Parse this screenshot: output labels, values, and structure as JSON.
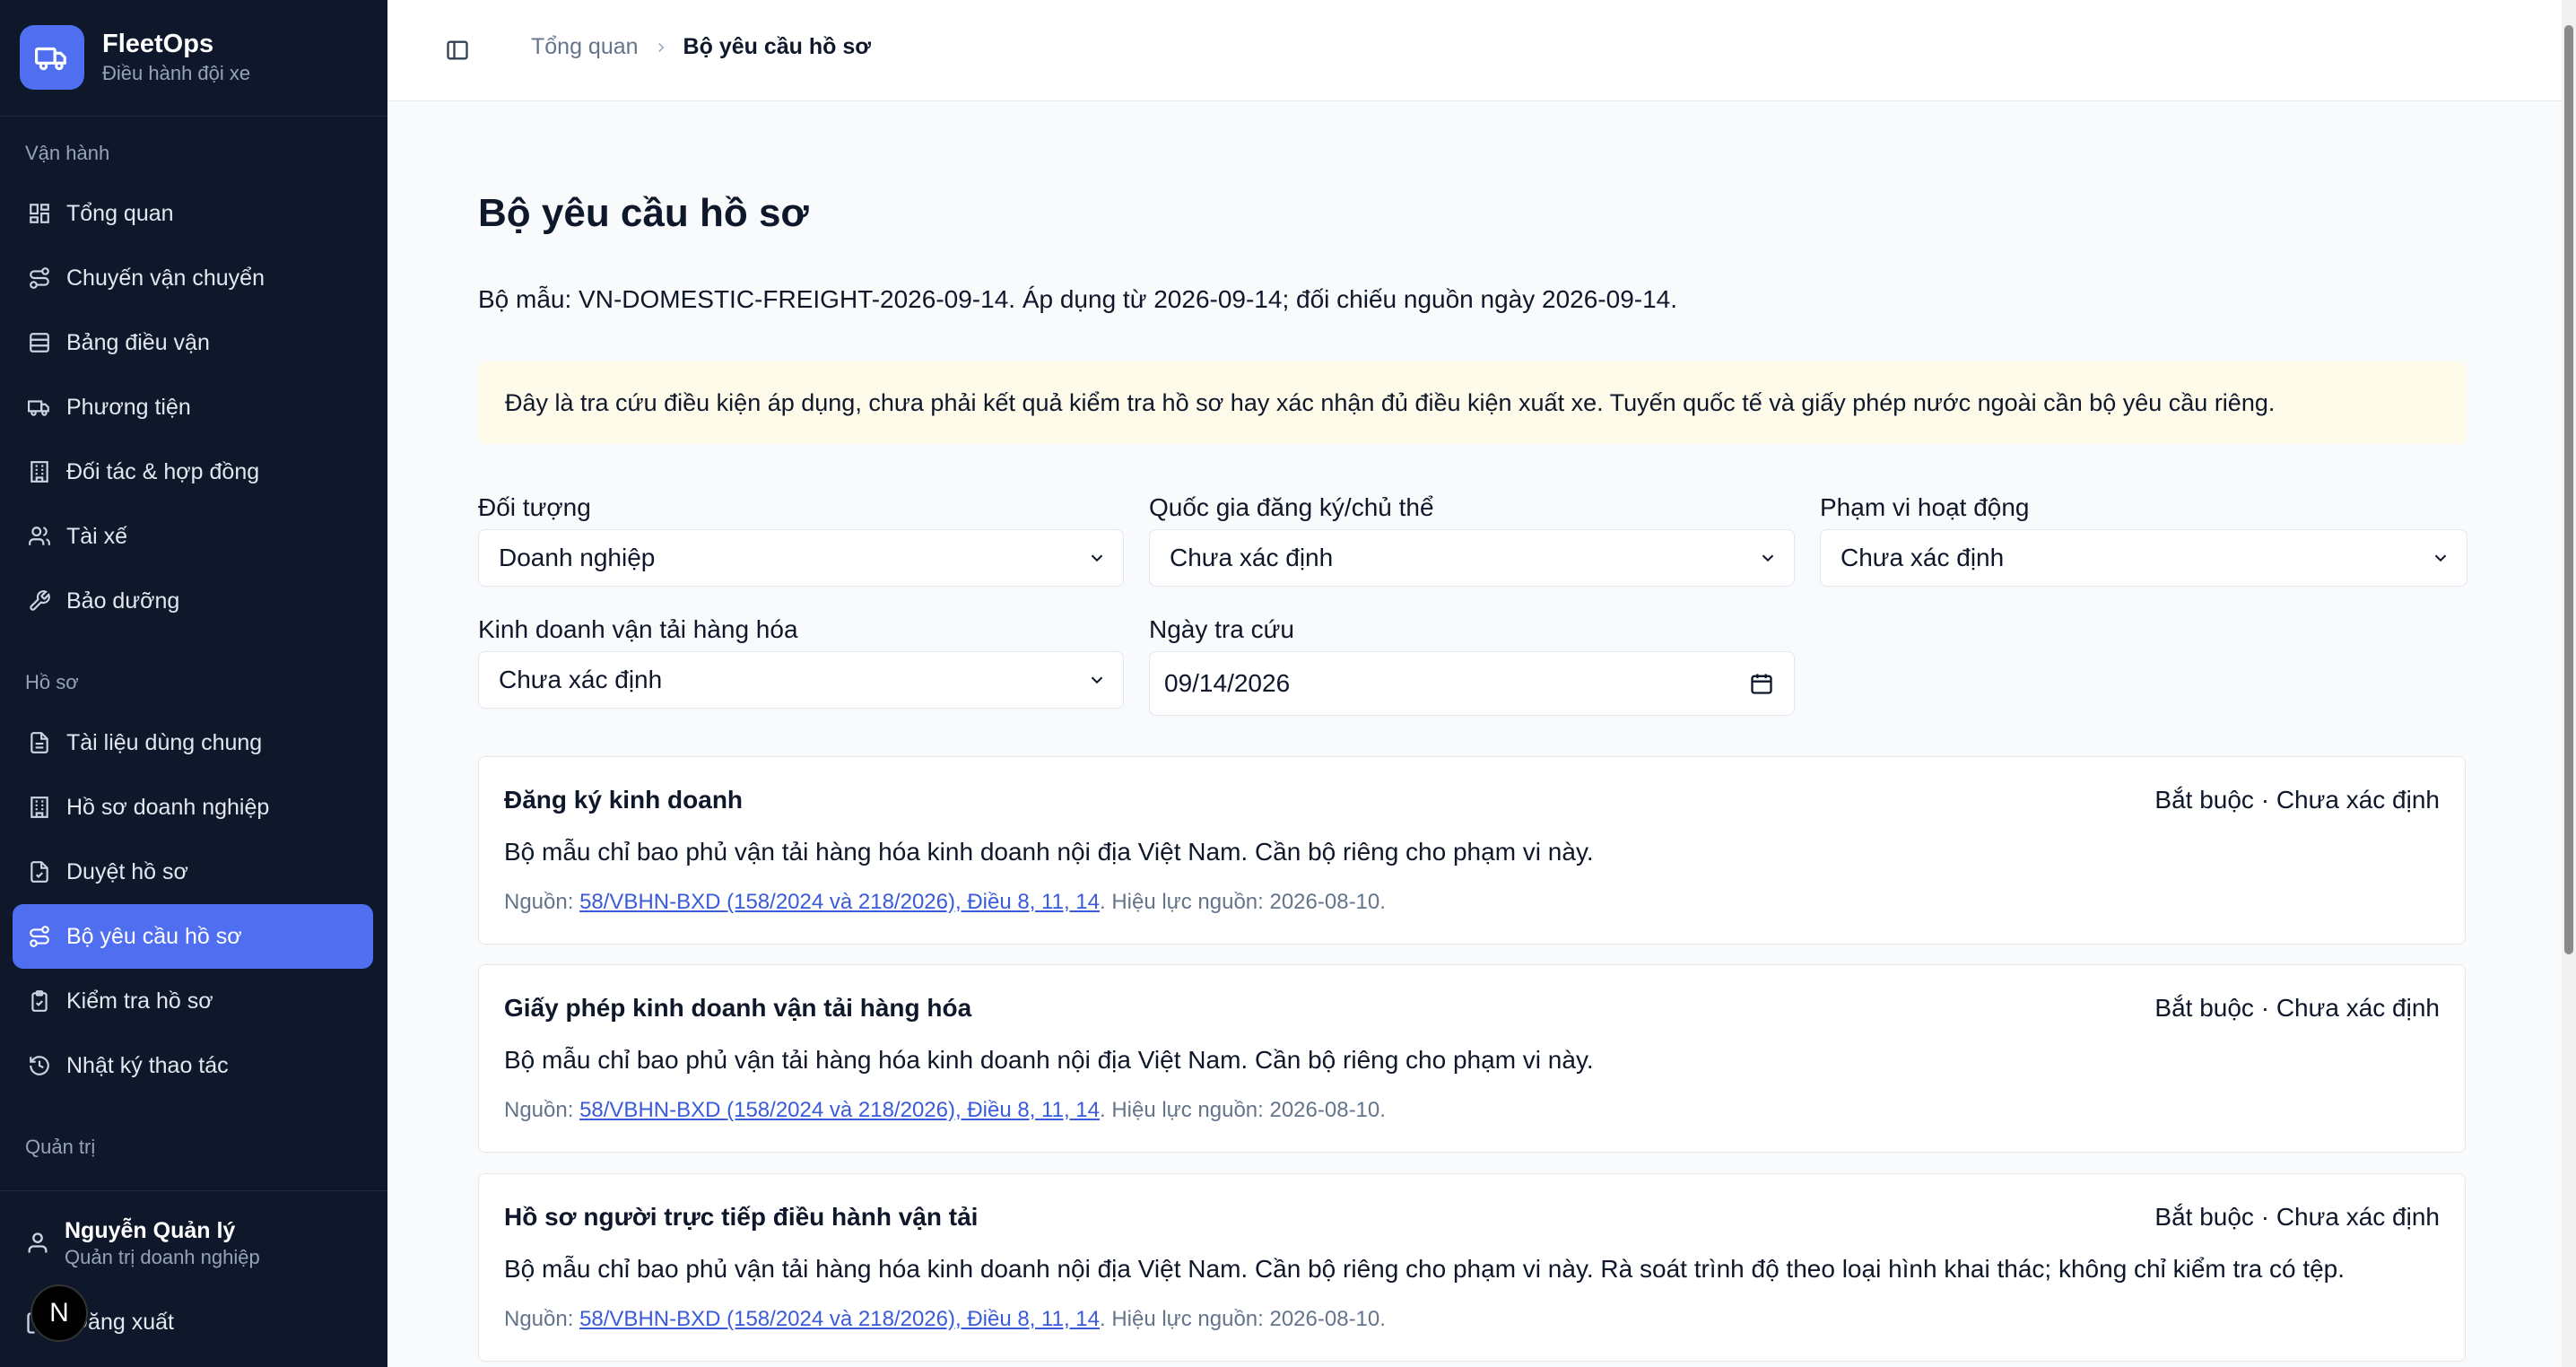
{
  "app": {
    "title": "FleetOps",
    "subtitle": "Điều hành đội xe"
  },
  "sidebar": {
    "sections": [
      {
        "label": "Vận hành"
      },
      {
        "label": "Hồ sơ"
      },
      {
        "label": "Quản trị"
      }
    ],
    "items": [
      {
        "label": "Tổng quan",
        "icon": "dashboard-icon"
      },
      {
        "label": "Chuyến vận chuyển",
        "icon": "route-icon"
      },
      {
        "label": "Bảng điều vận",
        "icon": "board-icon"
      },
      {
        "label": "Phương tiện",
        "icon": "truck-icon"
      },
      {
        "label": "Đối tác & hợp đồng",
        "icon": "building-icon"
      },
      {
        "label": "Tài xế",
        "icon": "users-icon"
      },
      {
        "label": "Bảo dưỡng",
        "icon": "wrench-icon"
      },
      {
        "label": "Tài liệu dùng chung",
        "icon": "file-icon"
      },
      {
        "label": "Hồ sơ doanh nghiệp",
        "icon": "building-icon"
      },
      {
        "label": "Duyệt hồ sơ",
        "icon": "file-check-icon"
      },
      {
        "label": "Bộ yêu cầu hồ sơ",
        "icon": "route-icon",
        "active": true
      },
      {
        "label": "Kiểm tra hồ sơ",
        "icon": "clipboard-check-icon"
      },
      {
        "label": "Nhật ký thao tác",
        "icon": "history-icon"
      }
    ],
    "user": {
      "name": "Nguyễn Quản lý",
      "role": "Quản trị doanh nghiệp"
    },
    "logout_label": "Đăng xuất",
    "badge_letter": "N"
  },
  "breadcrumb": {
    "parent": "Tổng quan",
    "current": "Bộ yêu cầu hồ sơ"
  },
  "page": {
    "title": "Bộ yêu cầu hồ sơ",
    "template_line": "Bộ mẫu: VN-DOMESTIC-FREIGHT-2026-09-14. Áp dụng từ 2026-09-14; đối chiếu nguồn ngày 2026-09-14.",
    "notice": "Đây là tra cứu điều kiện áp dụng, chưa phải kết quả kiểm tra hồ sơ hay xác nhận đủ điều kiện xuất xe. Tuyến quốc tế và giấy phép nước ngoài cần bộ yêu cầu riêng."
  },
  "filters": {
    "subject": {
      "label": "Đối tượng",
      "value": "Doanh nghiệp"
    },
    "country": {
      "label": "Quốc gia đăng ký/chủ thể",
      "value": "Chưa xác định"
    },
    "scope": {
      "label": "Phạm vi hoạt động",
      "value": "Chưa xác định"
    },
    "freight_business": {
      "label": "Kinh doanh vận tải hàng hóa",
      "value": "Chưa xác định"
    },
    "lookup_date": {
      "label": "Ngày tra cứu",
      "value": "09/14/2026"
    }
  },
  "requirements": [
    {
      "title": "Đăng ký kinh doanh",
      "status": "Bắt buộc · Chưa xác định",
      "description": "Bộ mẫu chỉ bao phủ vận tải hàng hóa kinh doanh nội địa Việt Nam. Cần bộ riêng cho phạm vi này.",
      "source_prefix": "Nguồn: ",
      "source_link": "58/VBHN-BXD (158/2024 và 218/2026), Điều 8, 11, 14",
      "source_suffix": ". Hiệu lực nguồn: 2026-08-10."
    },
    {
      "title": "Giấy phép kinh doanh vận tải hàng hóa",
      "status": "Bắt buộc · Chưa xác định",
      "description": "Bộ mẫu chỉ bao phủ vận tải hàng hóa kinh doanh nội địa Việt Nam. Cần bộ riêng cho phạm vi này.",
      "source_prefix": "Nguồn: ",
      "source_link": "58/VBHN-BXD (158/2024 và 218/2026), Điều 8, 11, 14",
      "source_suffix": ". Hiệu lực nguồn: 2026-08-10."
    },
    {
      "title": "Hồ sơ người trực tiếp điều hành vận tải",
      "status": "Bắt buộc · Chưa xác định",
      "description": "Bộ mẫu chỉ bao phủ vận tải hàng hóa kinh doanh nội địa Việt Nam. Cần bộ riêng cho phạm vi này. Rà soát trình độ theo loại hình khai thác; không chỉ kiểm tra có tệp.",
      "source_prefix": "Nguồn: ",
      "source_link": "58/VBHN-BXD (158/2024 và 218/2026), Điều 8, 11, 14",
      "source_suffix": ". Hiệu lực nguồn: 2026-08-10."
    }
  ],
  "colors": {
    "sidebar_bg": "#0f172a",
    "accent": "#4f6ef0",
    "notice_bg": "#fefbea",
    "link": "#3a5bd9"
  }
}
